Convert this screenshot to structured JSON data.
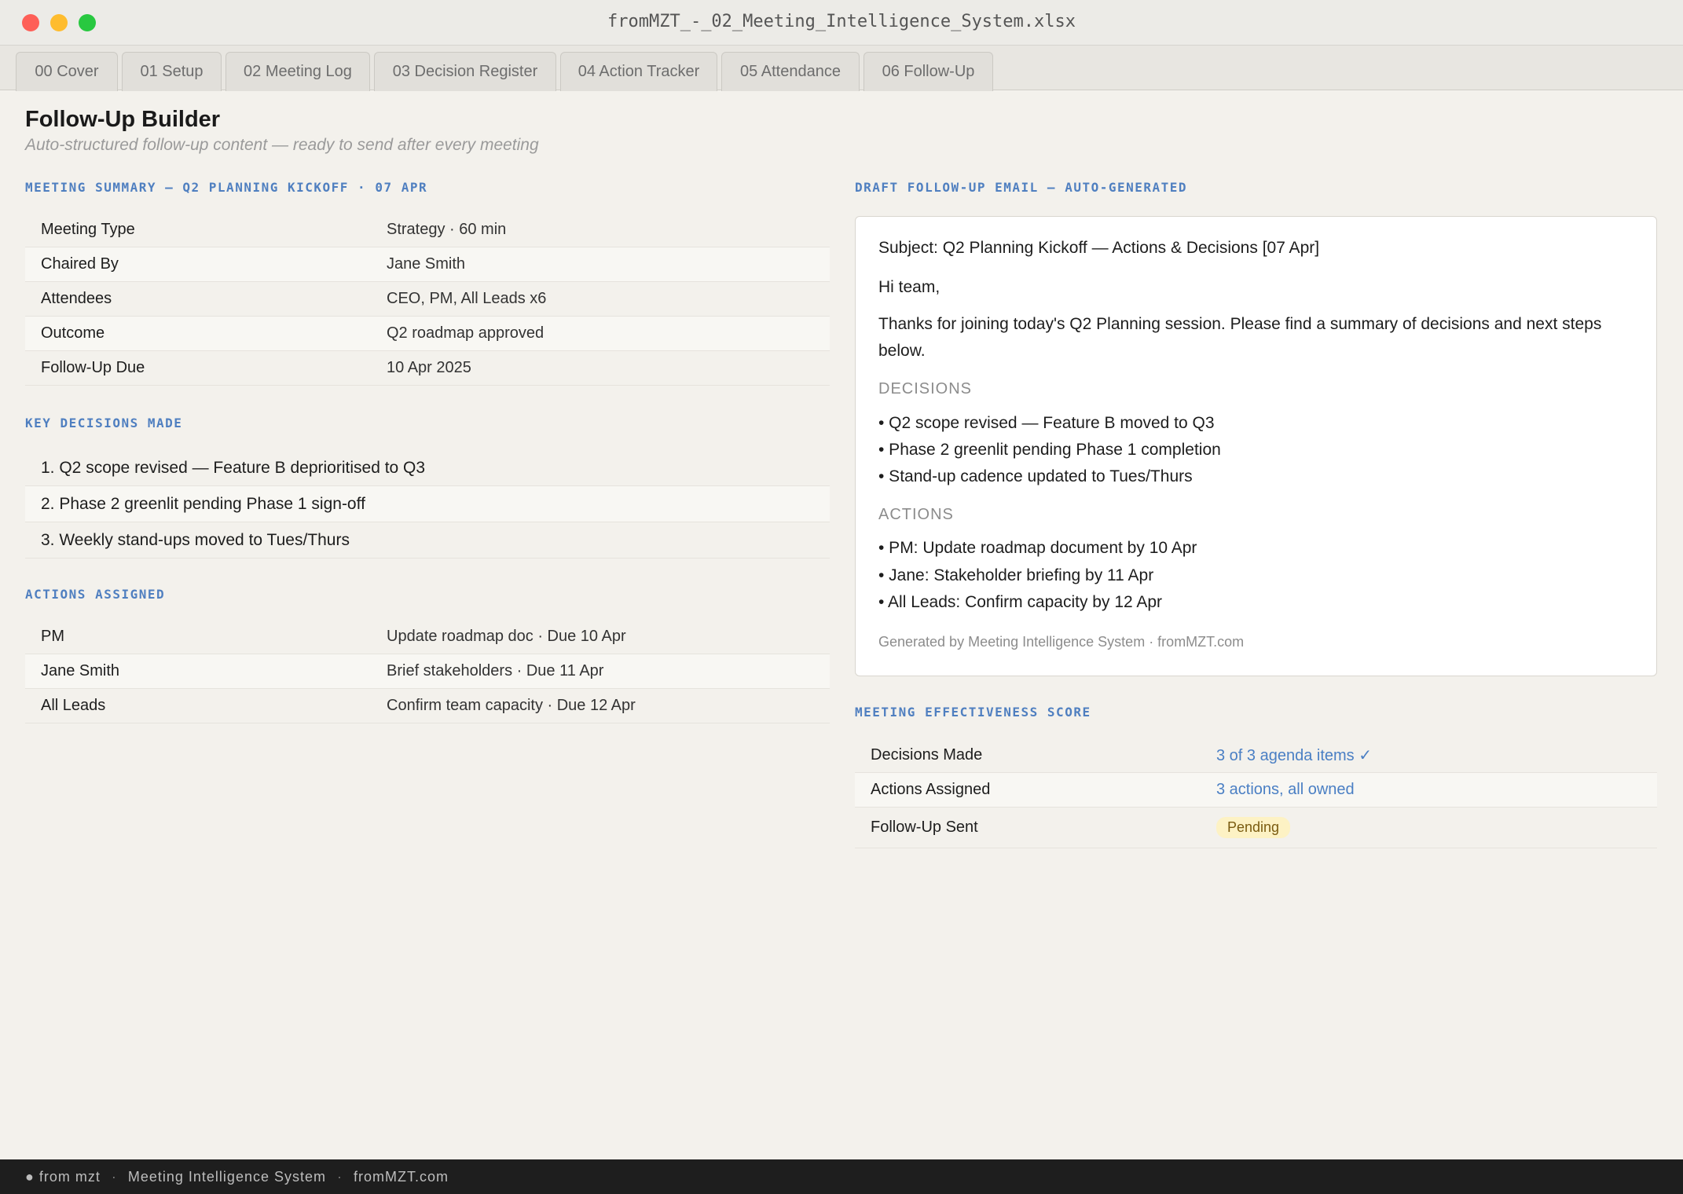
{
  "window": {
    "title": "fromMZT_-_02_Meeting_Intelligence_System.xlsx"
  },
  "tabs": [
    {
      "label": "00 Cover"
    },
    {
      "label": "01 Setup"
    },
    {
      "label": "02 Meeting Log"
    },
    {
      "label": "03 Decision Register"
    },
    {
      "label": "04 Action Tracker"
    },
    {
      "label": "05 Attendance"
    },
    {
      "label": "06 Follow-Up"
    }
  ],
  "page": {
    "title": "Follow-Up Builder",
    "subtitle": "Auto-structured follow-up content — ready to send after every meeting"
  },
  "summary": {
    "heading": "MEETING SUMMARY — Q2 PLANNING KICKOFF · 07 APR",
    "rows": [
      {
        "key": "Meeting Type",
        "value": "Strategy · 60 min"
      },
      {
        "key": "Chaired By",
        "value": "Jane Smith"
      },
      {
        "key": "Attendees",
        "value": "CEO, PM, All Leads x6"
      },
      {
        "key": "Outcome",
        "value": "Q2 roadmap approved"
      },
      {
        "key": "Follow-Up Due",
        "value": "10 Apr 2025"
      }
    ]
  },
  "decisions": {
    "heading": "KEY DECISIONS MADE",
    "items": [
      "1. Q2 scope revised — Feature B deprioritised to Q3",
      "2. Phase 2 greenlit pending Phase 1 sign-off",
      "3. Weekly stand-ups moved to Tues/Thurs"
    ]
  },
  "actions": {
    "heading": "ACTIONS ASSIGNED",
    "rows": [
      {
        "key": "PM",
        "value": "Update roadmap doc · Due 10 Apr"
      },
      {
        "key": "Jane Smith",
        "value": "Brief stakeholders · Due 11 Apr"
      },
      {
        "key": "All Leads",
        "value": "Confirm team capacity · Due 12 Apr"
      }
    ]
  },
  "email": {
    "heading": "DRAFT FOLLOW-UP EMAIL — AUTO-GENERATED",
    "subject": "Subject: Q2 Planning Kickoff — Actions & Decisions [07 Apr]",
    "greeting": "Hi team,",
    "body": "Thanks for joining today's Q2 Planning session. Please find a summary of decisions and next steps below.",
    "decisions_label": "DECISIONS",
    "decisions": [
      "• Q2 scope revised — Feature B moved to Q3",
      "• Phase 2 greenlit pending Phase 1 completion",
      "• Stand-up cadence updated to Tues/Thurs"
    ],
    "actions_label": "ACTIONS",
    "actions": [
      "• PM: Update roadmap document by 10 Apr",
      "• Jane: Stakeholder briefing by 11 Apr",
      "• All Leads: Confirm capacity by 12 Apr"
    ],
    "footer": "Generated by Meeting Intelligence System · fromMZT.com"
  },
  "score": {
    "heading": "MEETING EFFECTIVENESS SCORE",
    "rows": [
      {
        "key": "Decisions Made",
        "value": "3 of 3 agenda items ✓"
      },
      {
        "key": "Actions Assigned",
        "value": "3 actions, all owned"
      },
      {
        "key": "Follow-Up Sent",
        "value": "Pending"
      }
    ]
  },
  "footer": {
    "brand": "from mzt",
    "product": "Meeting Intelligence System",
    "site": "fromMZT.com"
  },
  "colors": {
    "accent": "#4f7fc0",
    "pending_badge": "#fdf2c4",
    "footer_bg": "#1e1e1e"
  }
}
